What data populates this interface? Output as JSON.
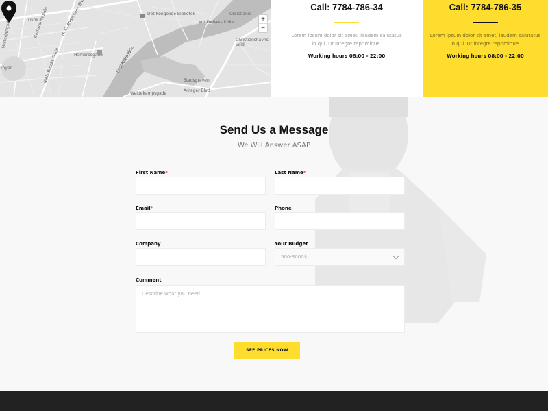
{
  "map": {
    "labels": {
      "library": "Det Kongelige Bibliotek",
      "christiania": "Christiania",
      "church": "Vor Frelsers Kirke",
      "christianshavns": "Christianshavns Vold",
      "tivoli": "Tivoli",
      "hambrosgade": "Hambrosgade",
      "stadsgraven": "Stadsgraven",
      "amager": "Amager Blvd",
      "byen": "•byen",
      "bernstorffsgade": "Bernstorffsgade",
      "niels": "Niels Brocks Gade",
      "hc": "H. C. Andersens Blvd",
      "vesterbro": "Vesterbrogade",
      "weidekampsgade": "Weidekampsgade",
      "englandsvej": "Englandsvej",
      "njalsgade": "Njalsgade"
    },
    "zoom_in": "+",
    "zoom_out": "−"
  },
  "cards": [
    {
      "phone": "Call: 7784-786-34",
      "desc": "Lorem ipsum dolor sit amet, laudem salutatus in qui. Ut integre reprimique.",
      "hours": "Working hours 08:00 - 22:00"
    },
    {
      "phone": "Call: 7784-786-35",
      "desc": "Lorem ipsum dolor sit amet, laudem salutatus in qui. Ut integre reprimique.",
      "hours": "Working hours 08:00 - 22:00"
    }
  ],
  "form": {
    "title": "Send Us a Message",
    "subtitle": "We Will Answer ASAP",
    "first_name_label": "First Name",
    "last_name_label": "Last Name",
    "email_label": "Email",
    "phone_label": "Phone",
    "company_label": "Company",
    "budget_label": "Your Budget",
    "budget_value": "500-3000$",
    "comment_label": "Comment",
    "comment_placeholder": "Describe what you need",
    "required_mark": "*",
    "submit_label": "SEE PRICES NOW"
  },
  "colors": {
    "accent": "#fedd2f",
    "footer": "#222222",
    "required": "#e14a4a"
  }
}
